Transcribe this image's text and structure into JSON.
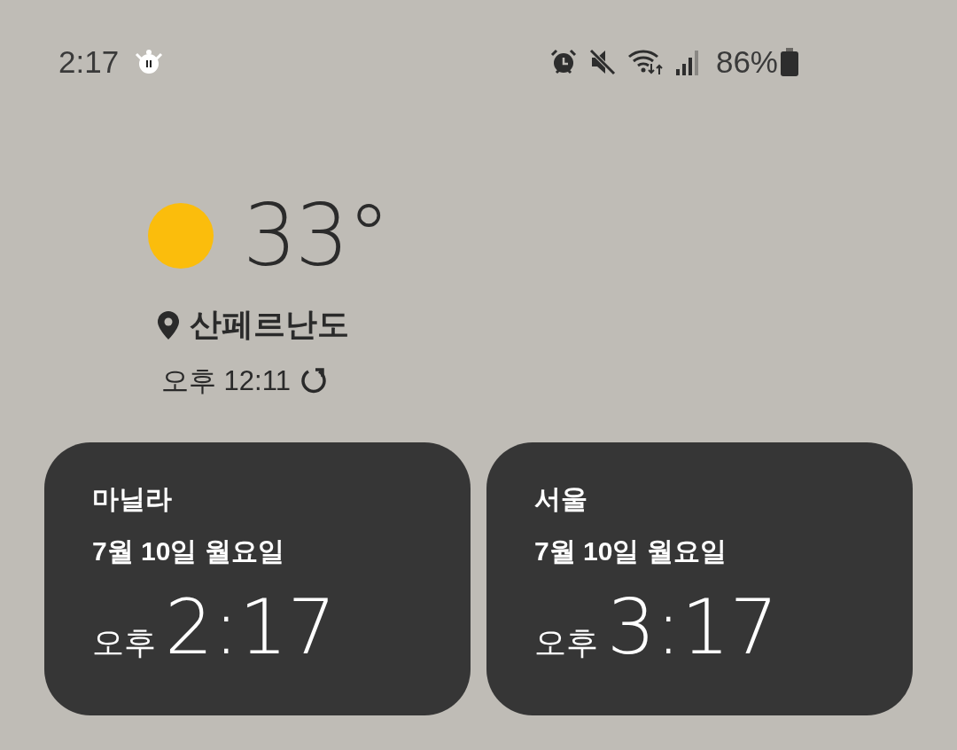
{
  "status_bar": {
    "time": "2:17",
    "battery": "86%"
  },
  "weather": {
    "temperature": "33°",
    "location": "산페르난도",
    "updated": "오후 12:11"
  },
  "clocks": [
    {
      "city": "마닐라",
      "date": "7월 10일 월요일",
      "ampm": "오후",
      "time": "2:17"
    },
    {
      "city": "서울",
      "date": "7월 10일 월요일",
      "ampm": "오후",
      "time": "3:17"
    }
  ]
}
